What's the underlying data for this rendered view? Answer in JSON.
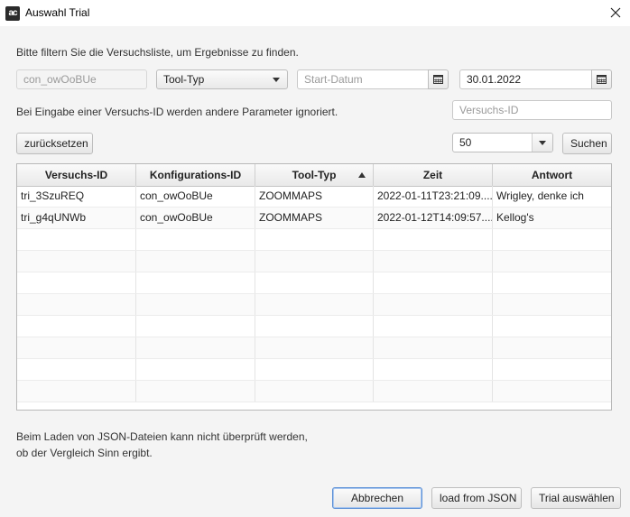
{
  "window": {
    "title": "Auswahl Trial",
    "app_icon_text": "ac"
  },
  "instructions": "Bitte filtern Sie die Versuchsliste, um Ergebnisse zu finden.",
  "filters": {
    "config_id_value": "con_owOoBUe",
    "tool_type_label": "Tool-Typ",
    "start_date_placeholder": "Start-Datum",
    "end_date_value": "30.01.2022",
    "trial_id_note": "Bei Eingabe einer Versuchs-ID werden andere Parameter ignoriert.",
    "trial_id_placeholder": "Versuchs-ID",
    "reset_label": "zurücksetzen",
    "limit_value": "50",
    "search_label": "Suchen"
  },
  "table": {
    "columns": [
      "Versuchs-ID",
      "Konfigurations-ID",
      "Tool-Typ",
      "Zeit",
      "Antwort"
    ],
    "sorted_column": "Tool-Typ",
    "sort_direction": "ascending",
    "rows": [
      [
        "tri_3SzuREQ",
        "con_owOoBUe",
        "ZOOMMAPS",
        "2022-01-11T23:21:09....",
        "Wrigley, denke ich"
      ],
      [
        "tri_g4qUNWb",
        "con_owOoBUe",
        "ZOOMMAPS",
        "2022-01-12T14:09:57....",
        "Kellog's"
      ]
    ]
  },
  "footer_note": {
    "line1": "Beim Laden von JSON-Dateien kann nicht überprüft werden,",
    "line2": "ob der Vergleich Sinn ergibt."
  },
  "buttons": {
    "cancel": "Abbrechen",
    "load_json": "load from JSON",
    "select_trial": "Trial auswählen"
  },
  "icons": {
    "close": "close-icon",
    "calendar": "calendar-icon",
    "dropdown": "chevron-down-icon",
    "sort": "sort-ascending-icon"
  }
}
